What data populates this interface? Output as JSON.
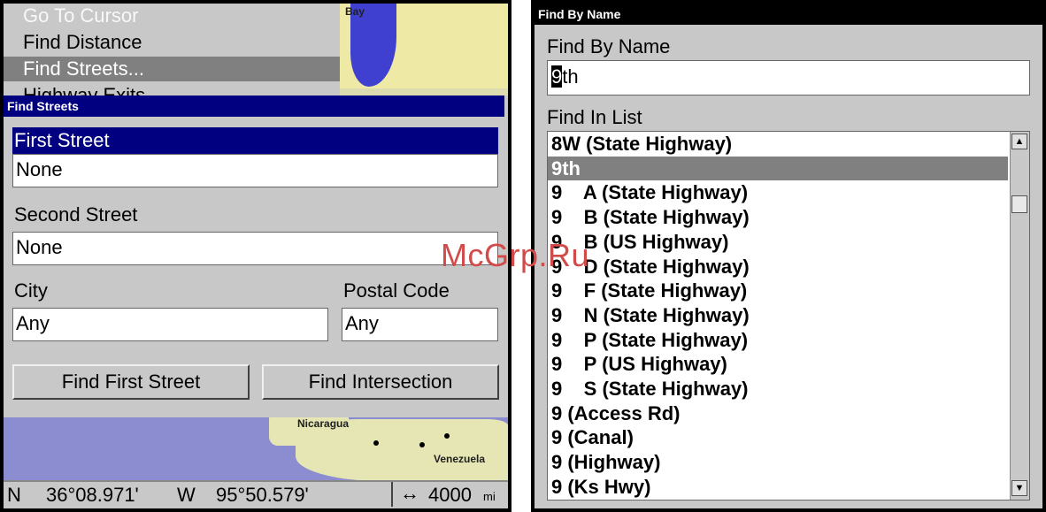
{
  "map": {
    "labels": {
      "bay": "Bay",
      "nicaragua": "Nicaragua",
      "venezuela": "Venezuela"
    },
    "colors": {
      "land": "#dcdcb0",
      "water": "#8c8cd0",
      "bay_water": "#4040d0"
    }
  },
  "menu": {
    "items": [
      {
        "label": "Go To Cursor"
      },
      {
        "label": "Find Distance"
      },
      {
        "label": "Find Streets..."
      },
      {
        "label": "Highway Exits"
      }
    ]
  },
  "find_streets": {
    "title": "Find Streets",
    "first_street": {
      "label": "First Street",
      "value": "None"
    },
    "second_street": {
      "label": "Second Street",
      "value": "None"
    },
    "city": {
      "label": "City",
      "value": "Any"
    },
    "postal_code": {
      "label": "Postal Code",
      "value": "Any"
    },
    "buttons": {
      "find_first": "Find First Street",
      "find_intersection": "Find Intersection"
    }
  },
  "status": {
    "lat_hemi": "N",
    "lat": "36°08.971'",
    "lon_hemi": "W",
    "lon": "95°50.579'",
    "scale_icon": "↔",
    "scale_value": "4000",
    "scale_unit": "mi"
  },
  "find_by_name": {
    "window_title": "Find By Name",
    "heading": "Find By Name",
    "input_cursor_char": "9",
    "input_rest": "th",
    "list_heading": "Find In List",
    "items": [
      "8W (State Highway)",
      "9th",
      "9    A (State Highway)",
      "9    B (State Highway)",
      "9    B (US Highway)",
      "9    D (State Highway)",
      "9    F (State Highway)",
      "9    N (State Highway)",
      "9    P (State Highway)",
      "9    P (US Highway)",
      "9    S (State Highway)",
      "9 (Access Rd)",
      "9 (Canal)",
      "9 (Highway)",
      "9 (Ks Hwy)"
    ],
    "selected_index": 1,
    "scroll": {
      "up_icon": "▲",
      "down_icon": "▼"
    }
  },
  "watermark": "McGrp.Ru",
  "colors": {
    "title_bar": "#000080",
    "selection": "#808080",
    "panel": "#c8c8c8"
  }
}
